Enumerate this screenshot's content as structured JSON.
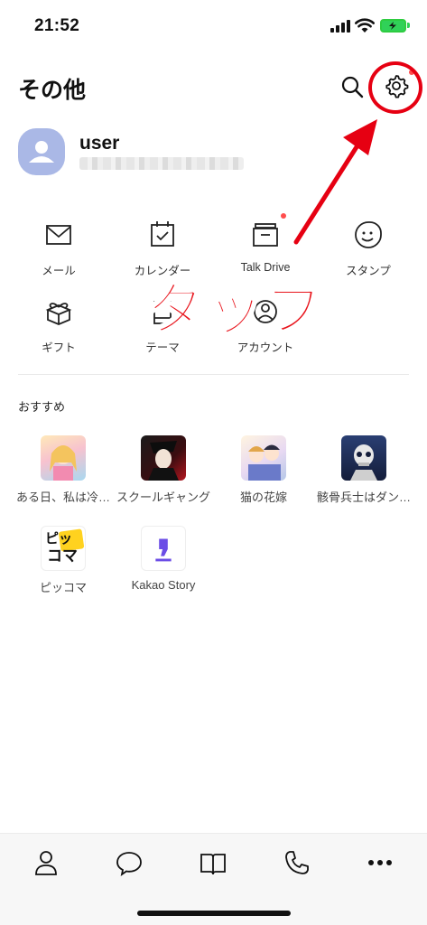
{
  "status_bar": {
    "time": "21:52"
  },
  "header": {
    "title": "その他",
    "search_icon": "search-icon",
    "settings_icon": "gear-icon"
  },
  "profile": {
    "name": "user"
  },
  "services": [
    {
      "label": "メール",
      "icon": "mail-icon"
    },
    {
      "label": "カレンダー",
      "icon": "calendar-icon"
    },
    {
      "label": "Talk Drive",
      "icon": "drive-icon"
    },
    {
      "label": "スタンプ",
      "icon": "sticker-icon"
    },
    {
      "label": "ギフト",
      "icon": "gift-icon"
    },
    {
      "label": "テーマ",
      "icon": "theme-icon"
    },
    {
      "label": "アカウント",
      "icon": "account-icon"
    }
  ],
  "recommended": {
    "title": "おすすめ",
    "apps": [
      {
        "label": "ある日、私は冷…"
      },
      {
        "label": "スクールギャング"
      },
      {
        "label": "猫の花嫁"
      },
      {
        "label": "骸骨兵士はダン…"
      },
      {
        "label": "ピッコマ",
        "logo_text_1": "ピッ",
        "logo_text_2": "コマ"
      },
      {
        "label": "Kakao Story"
      }
    ]
  },
  "annotation": {
    "text": "タップ"
  },
  "bottom_nav": [
    {
      "icon": "friends-icon"
    },
    {
      "icon": "chat-icon"
    },
    {
      "icon": "open-chat-icon"
    },
    {
      "icon": "call-icon"
    },
    {
      "icon": "more-icon"
    }
  ],
  "colors": {
    "accent_red": "#e60012",
    "badge_red": "#ff4d4d",
    "avatar_bg": "#aab8e6",
    "battery_green": "#30d158"
  }
}
